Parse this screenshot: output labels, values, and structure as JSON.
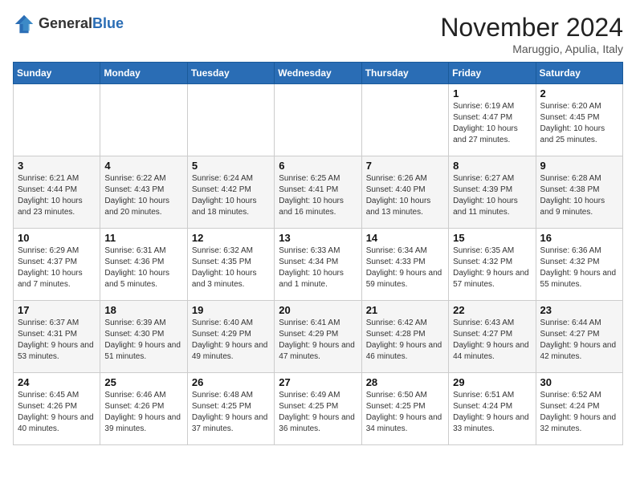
{
  "header": {
    "logo_general": "General",
    "logo_blue": "Blue",
    "month_title": "November 2024",
    "location": "Maruggio, Apulia, Italy"
  },
  "days_of_week": [
    "Sunday",
    "Monday",
    "Tuesday",
    "Wednesday",
    "Thursday",
    "Friday",
    "Saturday"
  ],
  "weeks": [
    [
      {
        "day": "",
        "info": ""
      },
      {
        "day": "",
        "info": ""
      },
      {
        "day": "",
        "info": ""
      },
      {
        "day": "",
        "info": ""
      },
      {
        "day": "",
        "info": ""
      },
      {
        "day": "1",
        "info": "Sunrise: 6:19 AM\nSunset: 4:47 PM\nDaylight: 10 hours and 27 minutes."
      },
      {
        "day": "2",
        "info": "Sunrise: 6:20 AM\nSunset: 4:45 PM\nDaylight: 10 hours and 25 minutes."
      }
    ],
    [
      {
        "day": "3",
        "info": "Sunrise: 6:21 AM\nSunset: 4:44 PM\nDaylight: 10 hours and 23 minutes."
      },
      {
        "day": "4",
        "info": "Sunrise: 6:22 AM\nSunset: 4:43 PM\nDaylight: 10 hours and 20 minutes."
      },
      {
        "day": "5",
        "info": "Sunrise: 6:24 AM\nSunset: 4:42 PM\nDaylight: 10 hours and 18 minutes."
      },
      {
        "day": "6",
        "info": "Sunrise: 6:25 AM\nSunset: 4:41 PM\nDaylight: 10 hours and 16 minutes."
      },
      {
        "day": "7",
        "info": "Sunrise: 6:26 AM\nSunset: 4:40 PM\nDaylight: 10 hours and 13 minutes."
      },
      {
        "day": "8",
        "info": "Sunrise: 6:27 AM\nSunset: 4:39 PM\nDaylight: 10 hours and 11 minutes."
      },
      {
        "day": "9",
        "info": "Sunrise: 6:28 AM\nSunset: 4:38 PM\nDaylight: 10 hours and 9 minutes."
      }
    ],
    [
      {
        "day": "10",
        "info": "Sunrise: 6:29 AM\nSunset: 4:37 PM\nDaylight: 10 hours and 7 minutes."
      },
      {
        "day": "11",
        "info": "Sunrise: 6:31 AM\nSunset: 4:36 PM\nDaylight: 10 hours and 5 minutes."
      },
      {
        "day": "12",
        "info": "Sunrise: 6:32 AM\nSunset: 4:35 PM\nDaylight: 10 hours and 3 minutes."
      },
      {
        "day": "13",
        "info": "Sunrise: 6:33 AM\nSunset: 4:34 PM\nDaylight: 10 hours and 1 minute."
      },
      {
        "day": "14",
        "info": "Sunrise: 6:34 AM\nSunset: 4:33 PM\nDaylight: 9 hours and 59 minutes."
      },
      {
        "day": "15",
        "info": "Sunrise: 6:35 AM\nSunset: 4:32 PM\nDaylight: 9 hours and 57 minutes."
      },
      {
        "day": "16",
        "info": "Sunrise: 6:36 AM\nSunset: 4:32 PM\nDaylight: 9 hours and 55 minutes."
      }
    ],
    [
      {
        "day": "17",
        "info": "Sunrise: 6:37 AM\nSunset: 4:31 PM\nDaylight: 9 hours and 53 minutes."
      },
      {
        "day": "18",
        "info": "Sunrise: 6:39 AM\nSunset: 4:30 PM\nDaylight: 9 hours and 51 minutes."
      },
      {
        "day": "19",
        "info": "Sunrise: 6:40 AM\nSunset: 4:29 PM\nDaylight: 9 hours and 49 minutes."
      },
      {
        "day": "20",
        "info": "Sunrise: 6:41 AM\nSunset: 4:29 PM\nDaylight: 9 hours and 47 minutes."
      },
      {
        "day": "21",
        "info": "Sunrise: 6:42 AM\nSunset: 4:28 PM\nDaylight: 9 hours and 46 minutes."
      },
      {
        "day": "22",
        "info": "Sunrise: 6:43 AM\nSunset: 4:27 PM\nDaylight: 9 hours and 44 minutes."
      },
      {
        "day": "23",
        "info": "Sunrise: 6:44 AM\nSunset: 4:27 PM\nDaylight: 9 hours and 42 minutes."
      }
    ],
    [
      {
        "day": "24",
        "info": "Sunrise: 6:45 AM\nSunset: 4:26 PM\nDaylight: 9 hours and 40 minutes."
      },
      {
        "day": "25",
        "info": "Sunrise: 6:46 AM\nSunset: 4:26 PM\nDaylight: 9 hours and 39 minutes."
      },
      {
        "day": "26",
        "info": "Sunrise: 6:48 AM\nSunset: 4:25 PM\nDaylight: 9 hours and 37 minutes."
      },
      {
        "day": "27",
        "info": "Sunrise: 6:49 AM\nSunset: 4:25 PM\nDaylight: 9 hours and 36 minutes."
      },
      {
        "day": "28",
        "info": "Sunrise: 6:50 AM\nSunset: 4:25 PM\nDaylight: 9 hours and 34 minutes."
      },
      {
        "day": "29",
        "info": "Sunrise: 6:51 AM\nSunset: 4:24 PM\nDaylight: 9 hours and 33 minutes."
      },
      {
        "day": "30",
        "info": "Sunrise: 6:52 AM\nSunset: 4:24 PM\nDaylight: 9 hours and 32 minutes."
      }
    ]
  ]
}
